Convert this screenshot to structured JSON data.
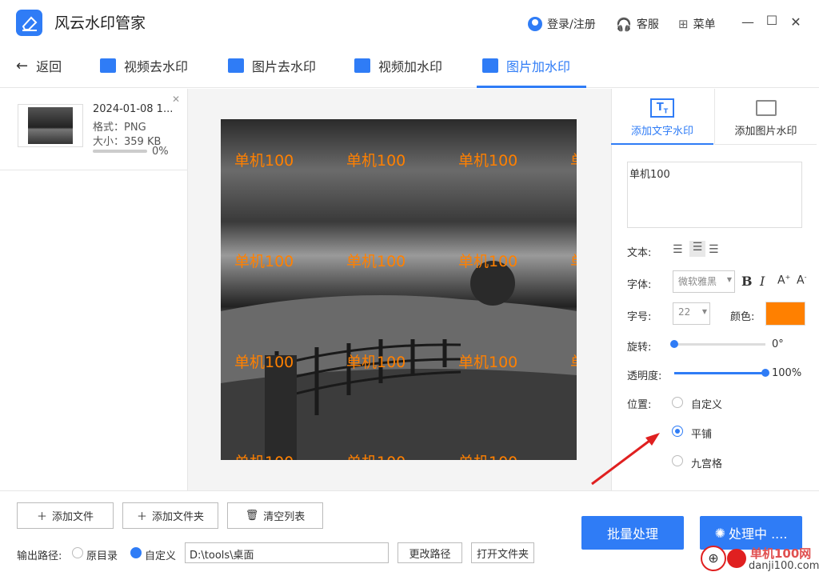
{
  "app": {
    "title": "风云水印管家"
  },
  "titlebar": {
    "login": "登录/注册",
    "service": "客服",
    "menu": "菜单"
  },
  "nav": {
    "back": "返回",
    "tabs": [
      "视频去水印",
      "图片去水印",
      "视频加水印",
      "图片加水印"
    ],
    "active": 3
  },
  "file": {
    "name": "2024-01-08 1...",
    "format": "格式：PNG",
    "size": "大小：359 KB",
    "progress": "0%",
    "progress_value": 0
  },
  "preview": {
    "watermark_text": "单机100",
    "watermark_color": "#ff8000"
  },
  "panel": {
    "tab_text": "添加文字水印",
    "tab_image": "添加图片水印",
    "text_value": "单机100",
    "label_text": "文本:",
    "label_font": "字体:",
    "font_value": "微软雅黑",
    "label_size": "字号:",
    "size_value": "22",
    "label_color": "颜色:",
    "color_value": "#ff8000",
    "label_rotate": "旋转:",
    "rotate_value": "0°",
    "rotate_fraction": 0,
    "label_opacity": "透明度:",
    "opacity_value": "100%",
    "opacity_fraction": 1,
    "label_position": "位置:",
    "positions": [
      "自定义",
      "平铺",
      "九宫格"
    ],
    "position_selected": 1
  },
  "bottom": {
    "add_file": "添加文件",
    "add_folder": "添加文件夹",
    "clear_list": "清空列表",
    "output_label": "输出路径:",
    "opt_original": "原目录",
    "opt_custom": "自定义",
    "path_value": "D:\\tools\\桌面",
    "change_path": "更改路径",
    "open_folder": "打开文件夹",
    "batch": "批量处理",
    "processing": "处理中 ....",
    "site": "单机100网",
    "site_url": "danji100.com"
  },
  "colors": {
    "accent": "#2f7cf6"
  }
}
